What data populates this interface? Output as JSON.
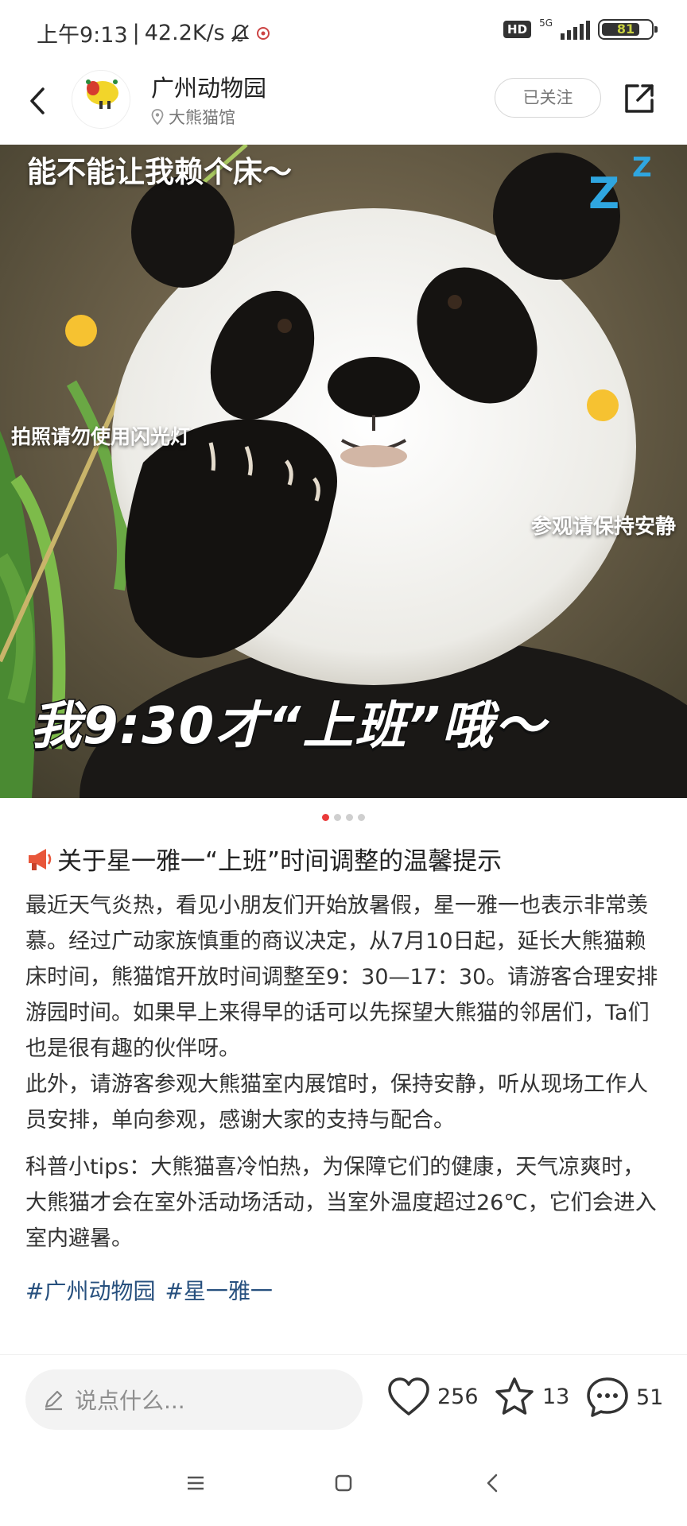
{
  "status_bar": {
    "time": "上午9:13",
    "speed": "42.2K/s",
    "hd": "HD",
    "network": "5G",
    "battery": "81",
    "battery_level": 0.81
  },
  "header": {
    "account_name": "广州动物园",
    "location": "大熊猫馆",
    "follow_label": "已关注",
    "avatar_text": "广州动物园"
  },
  "photo": {
    "caption_top": "能不能让我赖个床～",
    "caption_flash": "拍照请勿使用闪光灯",
    "caption_quiet": "参观请保持安静",
    "caption_big": "我9:30才“上班”哦～",
    "zzz": "Z"
  },
  "pager": {
    "total": 4,
    "active": 1
  },
  "article": {
    "title": "关于星一雅一“上班”时间调整的温馨提示",
    "paragraphs": [
      "最近天气炎热，看见小朋友们开始放暑假，星一雅一也表示非常羡慕。经过广动家族慎重的商议决定，从7月10日起，延长大熊猫赖床时间，熊猫馆开放时间调整至9：30—17：30。请游客合理安排游园时间。如果早上来得早的话可以先探望大熊猫的邻居们，Ta们也是很有趣的伙伴呀。",
      "此外，请游客参观大熊猫室内展馆时，保持安静，听从现场工作人员安排，单向参观，感谢大家的支持与配合。",
      "科普小tips：大熊猫喜冷怕热，为保障它们的健康，天气凉爽时，大熊猫才会在室外活动场活动，当室外温度超过26℃，它们会进入室内避暑。"
    ],
    "tags": [
      "#广州动物园",
      "#星一雅一"
    ]
  },
  "bottom_bar": {
    "comment_placeholder": "说点什么...",
    "likes": "256",
    "favorites": "13",
    "comments": "51"
  },
  "icons": {
    "back": "chevron-left-icon",
    "share": "share-icon",
    "like": "heart-icon",
    "favorite": "star-icon",
    "comment": "comment-bubble-icon",
    "edit": "pencil-icon",
    "megaphone": "megaphone-icon"
  }
}
